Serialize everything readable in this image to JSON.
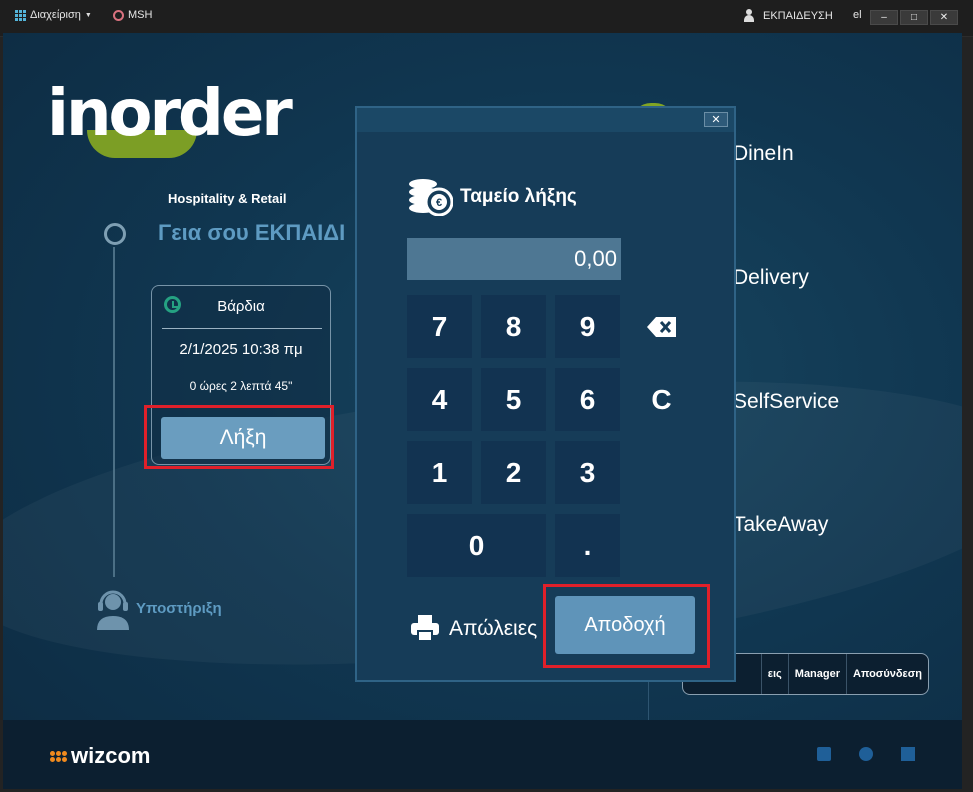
{
  "topbar": {
    "admin_label": "Διαχείριση",
    "store_label": "MSH",
    "user_label": "ΕΚΠΑΙΔΕΥΣΗ",
    "lang": "el",
    "minimize": "–",
    "maximize": "□",
    "close": "✕"
  },
  "logo": {
    "name": "inorder",
    "subtitle": "Hospitality & Retail"
  },
  "greeting": "Γεια σου ΕΚΠΑΙΔΙ",
  "shift": {
    "title": "Βάρδια",
    "date": "2/1/2025 10:38 πμ",
    "duration": "0 ώρες 2 λεπτά 45\"",
    "end_button": "Λήξη"
  },
  "support_label": "Υποστήριξη",
  "modes": [
    "DineIn",
    "Delivery",
    "SelfService",
    "TakeAway"
  ],
  "bottom_bar": {
    "items": [
      "εις",
      "Manager",
      "Αποσύνδεση"
    ]
  },
  "footer": {
    "brand": "wizcom"
  },
  "modal": {
    "close": "✕",
    "title": "Ταμείο λήξης",
    "display_value": "0,00",
    "keys": {
      "k7": "7",
      "k8": "8",
      "k9": "9",
      "k4": "4",
      "k5": "5",
      "k6": "6",
      "k1": "1",
      "k2": "2",
      "k3": "3",
      "k0": "0",
      "dot": ".",
      "clear": "C"
    },
    "print_label": "Απώλειες",
    "accept_label": "Αποδοχή"
  },
  "colors": {
    "accent": "#6a9dbf",
    "highlight": "#e0202a",
    "logo_green": "#8fb11f",
    "brand_orange": "#f08a1e"
  }
}
